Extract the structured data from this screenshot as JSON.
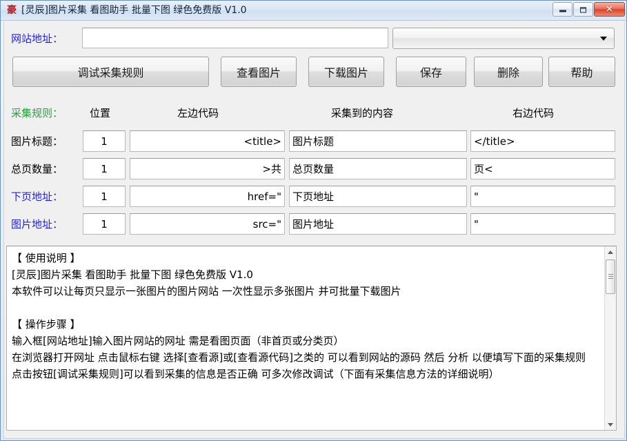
{
  "window": {
    "title": "[灵辰]图片采集 看图助手 批量下图 绿色免费版 V1.0",
    "icon": "app-icon",
    "minimize_label": "",
    "maximize_label": "",
    "close_label": "✕"
  },
  "address": {
    "label": "网站地址：",
    "value": "",
    "placeholder": "",
    "combo_value": "",
    "combo_arrow": "▼"
  },
  "toolbar": {
    "buttons": [
      {
        "label": "调试采集规则",
        "name": "debug-rules-button"
      },
      {
        "label": "查看图片",
        "name": "view-images-button"
      },
      {
        "label": "下载图片",
        "name": "download-images-button"
      },
      {
        "label": "保存",
        "name": "save-button"
      },
      {
        "label": "删除",
        "name": "delete-button"
      },
      {
        "label": "帮助",
        "name": "help-button"
      }
    ]
  },
  "rules": {
    "section_label": "采集规则：",
    "headers": {
      "position": "位置",
      "left_code": "左边代码",
      "content": "采集到的内容",
      "right_code": "右边代码"
    },
    "rows": [
      {
        "label": "图片标题：",
        "label_color": "black",
        "position": "1",
        "left_code": "<title>",
        "content": "图片标题",
        "right_code": "</title>"
      },
      {
        "label": "总页数量：",
        "label_color": "black",
        "position": "1",
        "left_code": ">共",
        "content": "总页数量",
        "right_code": "页<"
      },
      {
        "label": "下页地址：",
        "label_color": "blue",
        "position": "1",
        "left_code": "href=\"",
        "content": "下页地址",
        "right_code": "\""
      },
      {
        "label": "图片地址：",
        "label_color": "blue",
        "position": "1",
        "left_code": "src=\"",
        "content": "图片地址",
        "right_code": "\""
      }
    ]
  },
  "info": {
    "text": "【 使用说明 】\n[灵辰]图片采集 看图助手 批量下图 绿色免费版 V1.0\n本软件可以让每页只显示一张图片的图片网站 一次性显示多张图片 并可批量下载图片\n\n【 操作步骤 】\n输入框[网站地址]输入图片网站的网址 需是看图页面（非首页或分类页）\n在浏览器打开网址 点击鼠标右键 选择[查看源]或[查看源代码]之类的 可以看到网站的源码 然后 分析 以便填写下面的采集规则\n点击按钮[调试采集规则]可以看到采集的信息是否正确 可多次修改调试（下面有采集信息方法的详细说明）"
  },
  "colors": {
    "label_blue": "#2222dd",
    "label_green": "#2f9c42",
    "window_border": "#6d91bd",
    "client_bg": "#f0f0f0"
  }
}
